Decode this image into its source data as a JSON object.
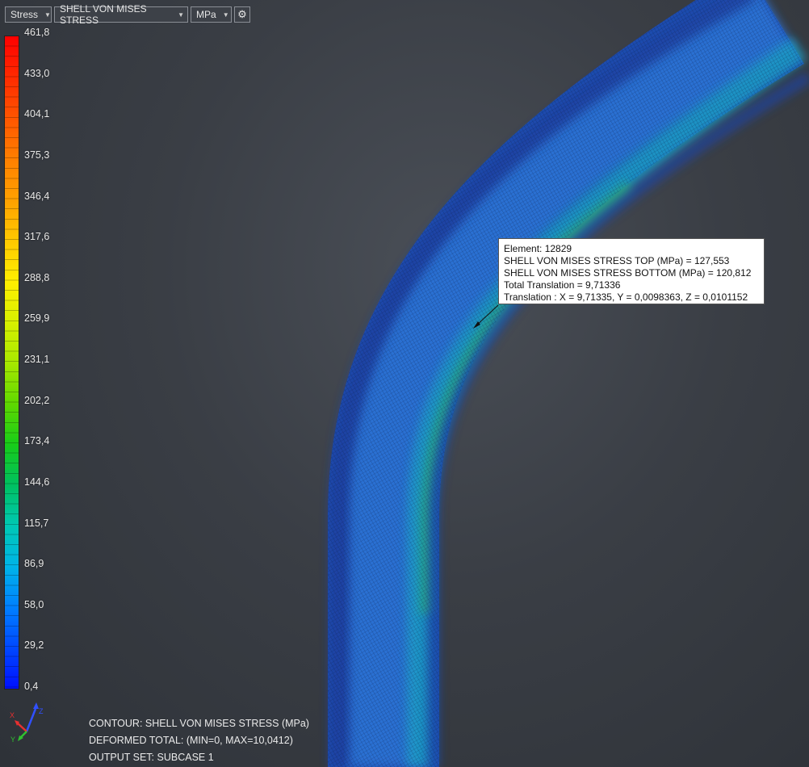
{
  "toolbar": {
    "result_type": "Stress",
    "result_component": "SHELL VON MISES STRESS",
    "units": "MPa",
    "settings_icon": "gear-icon"
  },
  "legend": {
    "labels": [
      "461,8",
      "433,0",
      "404,1",
      "375,3",
      "346,4",
      "317,6",
      "288,8",
      "259,9",
      "231,1",
      "202,2",
      "173,4",
      "144,6",
      "115,7",
      "86,9",
      "58,0",
      "29,2",
      "0,4"
    ],
    "colors": [
      "#ff0000",
      "#ff2a00",
      "#ff5500",
      "#ff7f00",
      "#ffa000",
      "#ffc800",
      "#ffee00",
      "#d8f000",
      "#a8e800",
      "#60d800",
      "#18cc18",
      "#00c060",
      "#00c8b4",
      "#00b4e8",
      "#0080ff",
      "#0048ff",
      "#0010ff"
    ]
  },
  "probe": {
    "element": "Element: 12829",
    "top": "SHELL VON MISES STRESS TOP (MPa)  = 127,553",
    "bottom": "SHELL VON MISES STRESS BOTTOM (MPa)  = 120,812",
    "total_translation": "Total Translation = 9,71336",
    "translation": "Translation : X = 9,71335, Y = 0,0098363, Z = 0,0101152"
  },
  "status": {
    "contour": "CONTOUR: SHELL VON MISES STRESS (MPa)",
    "deformed": "DEFORMED TOTAL: (MIN=0, MAX=10,0412)",
    "output_set": "OUTPUT SET: SUBCASE 1"
  },
  "triad": {
    "x": "X",
    "y": "Y",
    "z": "Z"
  }
}
